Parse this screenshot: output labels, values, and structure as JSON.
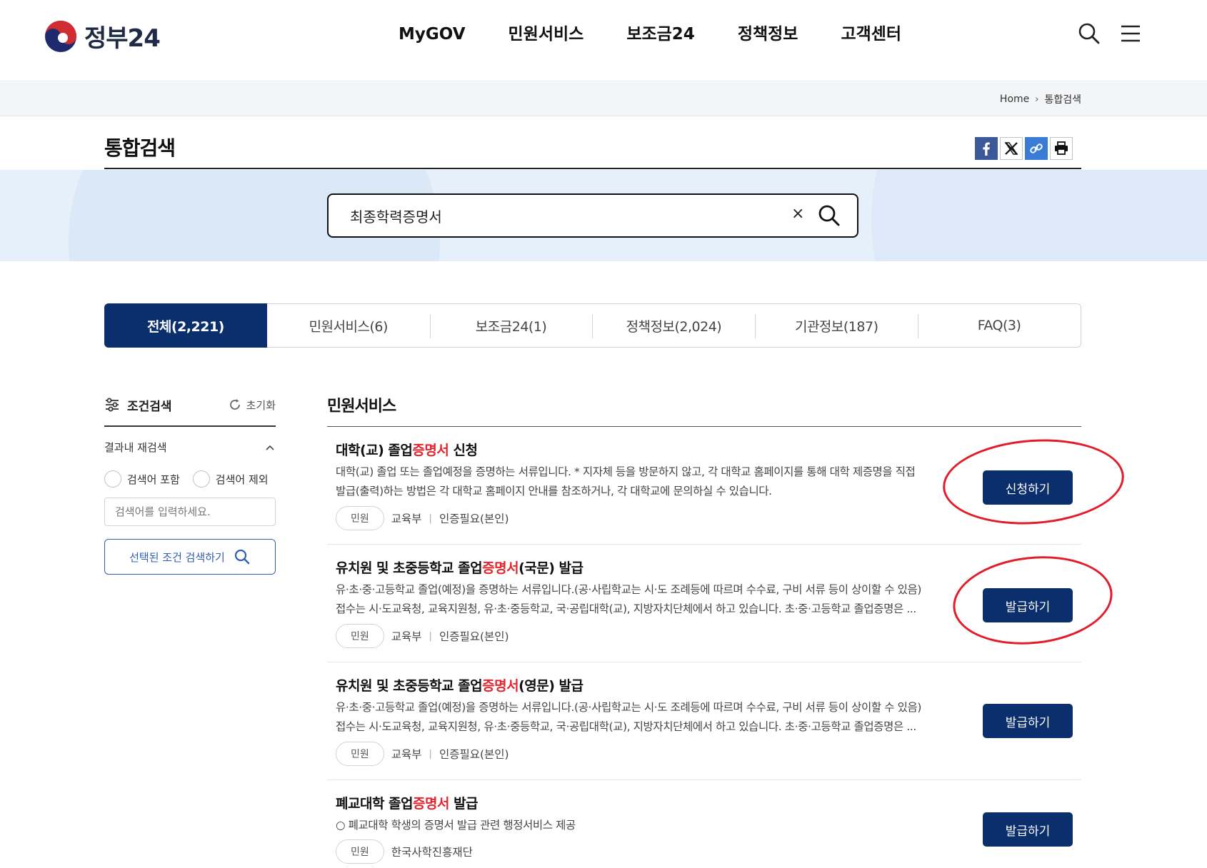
{
  "header": {
    "logo_text": "정부24",
    "nav": [
      "MyGOV",
      "민원서비스",
      "보조금24",
      "정책정보",
      "고객센터"
    ]
  },
  "breadcrumb": {
    "home": "Home",
    "current": "통합검색"
  },
  "page": {
    "title": "통합검색"
  },
  "search": {
    "value": "최종학력증명서",
    "clear": "×"
  },
  "tabs": [
    "전체(2,221)",
    "민원서비스(6)",
    "보조금24(1)",
    "정책정보(2,024)",
    "기관정보(187)",
    "FAQ(3)"
  ],
  "sidebar": {
    "title": "조건검색",
    "reset": "초기화",
    "research_label": "결과내 재검색",
    "radio_include": "검색어 포함",
    "radio_exclude": "검색어 제외",
    "input_placeholder": "검색어를 입력하세요.",
    "button": "선택된 조건 검색하기"
  },
  "results": {
    "section_title": "민원서비스",
    "items": [
      {
        "title_pre": "대학(교) 졸업",
        "title_hl": "증명서",
        "title_post": " 신청",
        "desc1": "대학(교) 졸업 또는 졸업예정을 증명하는 서류입니다. * 지자체 등을 방문하지 않고, 각 대학교 홈페이지를 통해 대학 제증명을 직접",
        "desc2": "발급(출력)하는 방법은 각 대학교 홈페이지 안내를 참조하거나, 각 대학교에 문의하실 수 있습니다.",
        "tag": "민원",
        "org": "교육부",
        "auth": "인증필요(본인)",
        "button": "신청하기"
      },
      {
        "title_pre": "유치원 및 초중등학교 졸업",
        "title_hl": "증명서",
        "title_post": "(국문) 발급",
        "desc1": "유·초·중·고등학교 졸업(예정)을 증명하는 서류입니다.(공·사립학교는 시·도 조례등에 따르며 수수료, 구비 서류 등이 상이할 수 있음)",
        "desc2": "접수는 시·도교육청, 교육지원청, 유·초·중등학교, 국·공립대학(교), 지방자치단체에서 하고 있습니다. 초·중·고등학교 졸업증명은 ...",
        "tag": "민원",
        "org": "교육부",
        "auth": "인증필요(본인)",
        "button": "발급하기"
      },
      {
        "title_pre": "유치원 및 초중등학교 졸업",
        "title_hl": "증명서",
        "title_post": "(영문) 발급",
        "desc1": "유·초·중·고등학교 졸업(예정)을 증명하는 서류입니다.(공·사립학교는 시·도 조례등에 따르며 수수료, 구비 서류 등이 상이할 수 있음)",
        "desc2": "접수는 시·도교육청, 교육지원청, 유·초·중등학교, 국·공립대학(교), 지방자치단체에서 하고 있습니다. 초·중·고등학교 졸업증명은 ...",
        "tag": "민원",
        "org": "교육부",
        "auth": "인증필요(본인)",
        "button": "발급하기"
      },
      {
        "title_pre": "폐교대학 졸업",
        "title_hl": "증명서",
        "title_post": " 발급",
        "desc1": "○ 폐교대학 학생의 증명서 발급 관련 행정서비스 제공",
        "tag": "민원",
        "org": "한국사학진흥재단",
        "button": "발급하기"
      }
    ]
  },
  "colors": {
    "brand_navy": "#0b2e6d",
    "highlight_red": "#e0262e",
    "annotation_red": "#e11d2a"
  }
}
